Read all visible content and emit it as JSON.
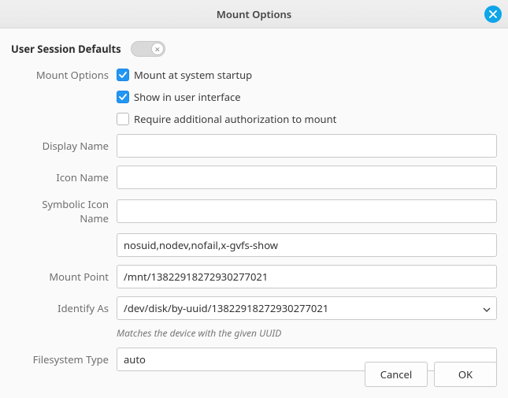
{
  "window": {
    "title": "Mount Options"
  },
  "defaults": {
    "label": "User Session Defaults",
    "enabled": false
  },
  "labels": {
    "mount_options": "Mount Options",
    "display_name": "Display Name",
    "icon_name": "Icon Name",
    "symbolic_icon_name": "Symbolic Icon Name",
    "mount_point": "Mount Point",
    "identify_as": "Identify As",
    "filesystem_type": "Filesystem Type"
  },
  "checkboxes": {
    "startup": {
      "label": "Mount at system startup",
      "checked": true
    },
    "show_ui": {
      "label": "Show in user interface",
      "checked": true
    },
    "require_auth": {
      "label": "Require additional authorization to mount",
      "checked": false
    }
  },
  "fields": {
    "display_name": "",
    "icon_name": "",
    "symbolic_icon_name": "",
    "options_string": "nosuid,nodev,nofail,x-gvfs-show",
    "mount_point": "/mnt/13822918272930277021",
    "identify_as": "/dev/disk/by-uuid/13822918272930277021",
    "identify_hint": "Matches the device with the given UUID",
    "filesystem_type": "auto"
  },
  "buttons": {
    "cancel": "Cancel",
    "ok": "OK"
  }
}
